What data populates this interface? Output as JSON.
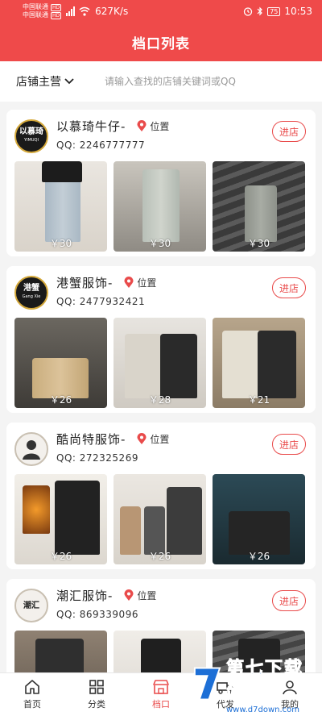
{
  "status_bar": {
    "carrier_1": "中国联通",
    "carrier_2": "中国联通",
    "hd": "HD",
    "speed": "627K/s",
    "battery": "75",
    "time": "10:53"
  },
  "header": {
    "title": "档口列表"
  },
  "search": {
    "filter_label": "店铺主营",
    "placeholder": "请输入查找的店铺关键词或QQ"
  },
  "shops": [
    {
      "name": "以慕琦牛仔-",
      "avatar_text": "以慕琦",
      "avatar_sub": "YIMUQI",
      "location_label": "位置",
      "qq": "QQ:  2246777777",
      "button_label": "进店",
      "prices": [
        "￥30",
        "￥30",
        "￥30"
      ]
    },
    {
      "name": "港蟹服饰-",
      "avatar_text": "港蟹",
      "avatar_sub": "Gang Xie",
      "location_label": "位置",
      "qq": "QQ:  2477932421",
      "button_label": "进店",
      "prices": [
        "￥26",
        "￥28",
        "￥21"
      ]
    },
    {
      "name": "酷尚特服饰-",
      "avatar_text": "",
      "avatar_sub": "",
      "location_label": "位置",
      "qq": "QQ:  272325269",
      "button_label": "进店",
      "prices": [
        "￥26",
        "￥26",
        "￥26"
      ]
    },
    {
      "name": "潮汇服饰-",
      "avatar_text": "潮汇",
      "avatar_sub": "",
      "location_label": "位置",
      "qq": "QQ:  869339096",
      "button_label": "进店",
      "prices": [
        "",
        "",
        ""
      ]
    }
  ],
  "bottom_nav": {
    "items": [
      {
        "label": "首页",
        "icon": "home-icon"
      },
      {
        "label": "分类",
        "icon": "grid-icon"
      },
      {
        "label": "档口",
        "icon": "store-icon"
      },
      {
        "label": "代发",
        "icon": "truck-icon"
      },
      {
        "label": "我的",
        "icon": "user-icon"
      }
    ],
    "active_index": 2
  },
  "watermark": {
    "title": "第七下载站",
    "url": "www.d7down.com"
  },
  "colors": {
    "accent": "#ef4a4a",
    "button_border": "#e94b4b",
    "background": "#f4f4f4"
  }
}
